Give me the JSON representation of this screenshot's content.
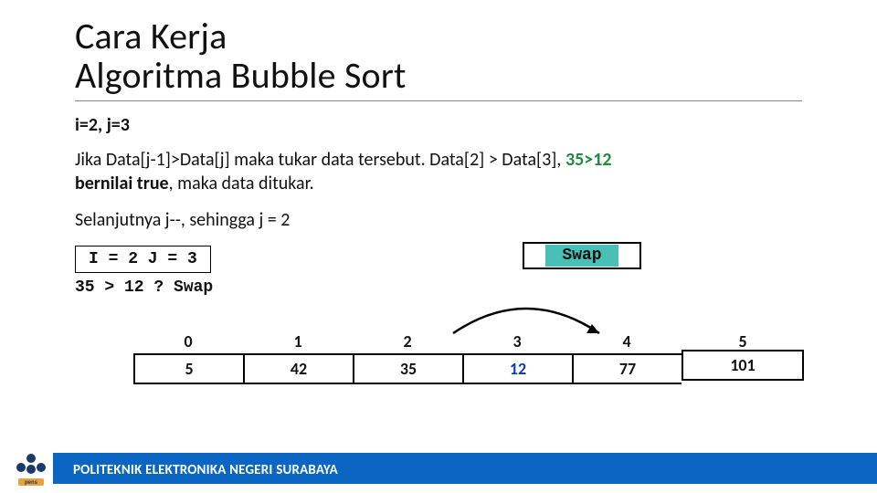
{
  "title": "Cara Kerja\nAlgoritma Bubble Sort",
  "state_label": "i=2, j=3",
  "paragraph": {
    "lead": "Jika Data[j-1]>Data[j] maka tukar data tersebut. Data[2] > Data[3], ",
    "compare_highlight": "35>12",
    "tail_a": "bernilai true",
    "tail_b": ", maka data ditukar."
  },
  "next_step": "Selanjutnya j--, sehingga j = 2",
  "ij_box": "I = 2 J = 3",
  "condition": "35 > 12 ?  Swap",
  "swap_label": "Swap",
  "array": {
    "indices": [
      "0",
      "1",
      "2",
      "3",
      "4",
      "5"
    ],
    "values": [
      "5",
      "42",
      "35",
      "12",
      "77",
      "101"
    ],
    "highlight_index": 3
  },
  "footer": "POLITEKNIK ELEKTRONIKA NEGERI SURABAYA",
  "colors": {
    "accent_teal": "#49c0b6",
    "footer_blue": "#0a66c2",
    "highlight_text": "#0b3ea8",
    "swap_green": "#1f8a3b"
  },
  "chart_data": {
    "type": "table",
    "title": "Bubble Sort state at i=2, j=3",
    "categories": [
      0,
      1,
      2,
      3,
      4,
      5
    ],
    "values": [
      5,
      42,
      35,
      12,
      77,
      101
    ],
    "annotations": {
      "compare": [
        2,
        3
      ],
      "swap": true
    }
  }
}
